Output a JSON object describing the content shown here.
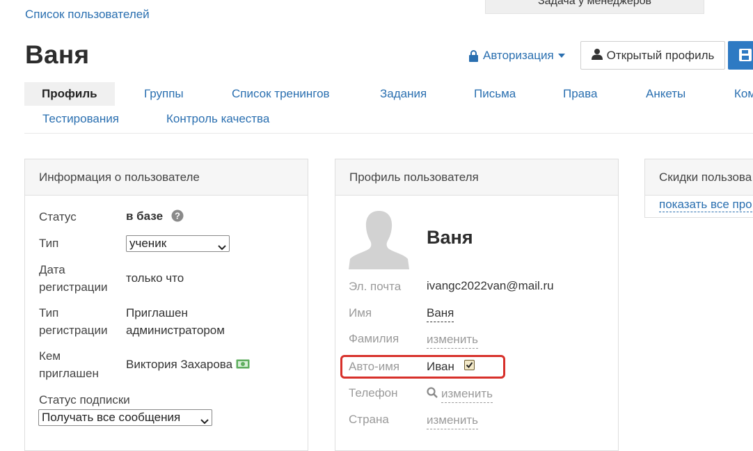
{
  "nav": {
    "back_link": "Список пользователей",
    "top_button": "Задача у менеджеров"
  },
  "header": {
    "title": "Ваня",
    "auth_dropdown": "Авторизация",
    "open_profile_button": "Открытый профиль"
  },
  "tabs": {
    "row1": [
      "Профиль",
      "Группы",
      "Список тренингов",
      "Задания",
      "Письма",
      "Права",
      "Анкеты",
      "Ком"
    ],
    "row2": [
      "Тестирования",
      "Контроль качества"
    ]
  },
  "user_info": {
    "title": "Информация о пользователе",
    "status_label": "Статус",
    "status_value": "в базе",
    "type_label": "Тип",
    "type_value": "ученик",
    "reg_date_label_1": "Дата",
    "reg_date_label_2": "регистрации",
    "reg_date_value": "только что",
    "reg_type_label_1": "Тип",
    "reg_type_label_2": "регистрации",
    "reg_type_value_1": "Приглашен",
    "reg_type_value_2": "администратором",
    "invited_label_1": "Кем",
    "invited_label_2": "приглашен",
    "invited_value": "Виктория Захарова",
    "subscription_label": "Статус подписки",
    "subscription_value": "Получать все сообщения"
  },
  "profile": {
    "title": "Профиль пользователя",
    "name": "Ваня",
    "email_label": "Эл. почта",
    "email_value": "ivangc2022van@mail.ru",
    "first_name_label": "Имя",
    "first_name_value": "Ваня",
    "last_name_label": "Фамилия",
    "last_name_value": "изменить",
    "auto_name_label": "Авто-имя",
    "auto_name_value": "Иван",
    "auto_name_checked": true,
    "phone_label": "Телефон",
    "phone_value": "изменить",
    "country_label": "Страна",
    "country_value": "изменить"
  },
  "discounts": {
    "title": "Скидки пользова",
    "show_all_link": "показать все про"
  },
  "colors": {
    "link": "#2a6fb0",
    "primary_button": "#2e7ac3",
    "highlight_border": "#d7302a"
  }
}
